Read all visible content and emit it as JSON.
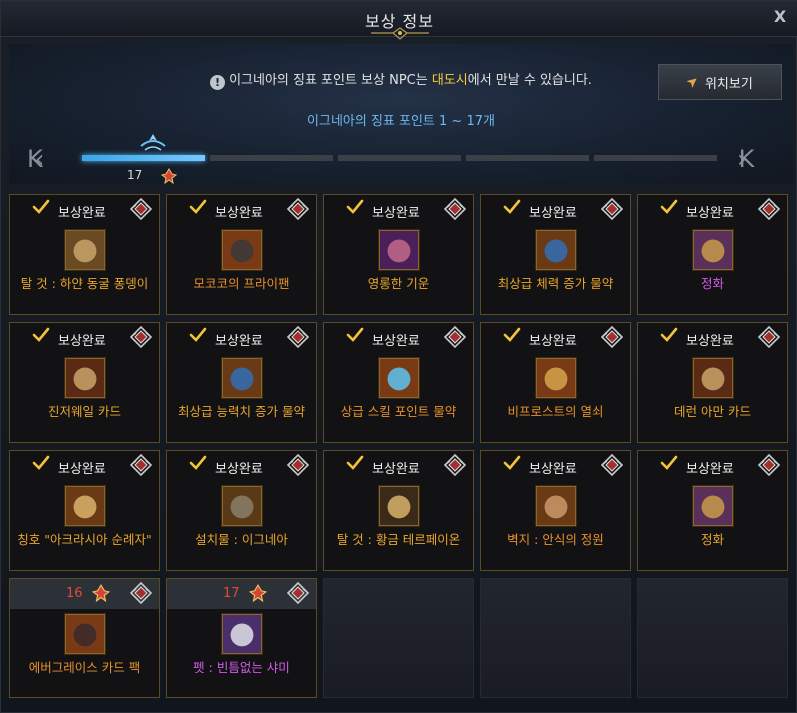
{
  "window": {
    "title": "보상 정보",
    "close_label": "X"
  },
  "info": {
    "notice_prefix": "이그네아의 징표 포인트 보상 NPC는 ",
    "notice_highlight": "대도시",
    "notice_suffix": "에서 만날 수 있습니다.",
    "locate_label": "위치보기",
    "range_label": "이그네아의 징표 포인트 1 ~ 17개",
    "nav_prev": "K‹",
    "nav_next": "›K",
    "current_level": "17",
    "progress_segments": 5,
    "progress_active_segment": 1
  },
  "rewards": [
    {
      "status": "보상완료",
      "name": "탈 것 : 하얀 동굴 퐁뎅이",
      "color": "gold",
      "icon": "pouch-icon"
    },
    {
      "status": "보상완료",
      "name": "모코코의 프라이팬",
      "color": "orange",
      "icon": "frying-pan-icon"
    },
    {
      "status": "보상완료",
      "name": "영롱한 기운",
      "color": "gold",
      "icon": "aura-icon"
    },
    {
      "status": "보상완료",
      "name": "최상급 체력 증가 물약",
      "color": "gold",
      "icon": "potion-icon"
    },
    {
      "status": "보상완료",
      "name": "정화",
      "color": "purple",
      "icon": "rune-icon"
    },
    {
      "status": "보상완료",
      "name": "진저웨일 카드",
      "color": "gold",
      "icon": "card-icon"
    },
    {
      "status": "보상완료",
      "name": "최상급 능력치 증가 물약",
      "color": "gold",
      "icon": "potion-icon"
    },
    {
      "status": "보상완료",
      "name": "상급 스킬 포인트 물약",
      "color": "orange",
      "icon": "bottle-icon"
    },
    {
      "status": "보상완료",
      "name": "비프로스트의 열쇠",
      "color": "orange",
      "icon": "key-icon"
    },
    {
      "status": "보상완료",
      "name": "데런 아만 카드",
      "color": "gold",
      "icon": "card-icon"
    },
    {
      "status": "보상완료",
      "name": "칭호 \"아크라시아 순례자\"",
      "color": "gold",
      "icon": "scroll-icon"
    },
    {
      "status": "보상완료",
      "name": "설치물 : 이그네아",
      "color": "gold",
      "icon": "statue-icon"
    },
    {
      "status": "보상완료",
      "name": "탈 것 : 황금 테르페이온",
      "color": "gold",
      "icon": "horse-icon"
    },
    {
      "status": "보상완료",
      "name": "벽지 : 안식의 정원",
      "color": "orange",
      "icon": "parchment-icon"
    },
    {
      "status": "보상완료",
      "name": "정화",
      "color": "gold",
      "icon": "rune-icon"
    },
    {
      "status_num": "16",
      "name": "에버그레이스 카드 팩",
      "color": "orange",
      "icon": "card-pack-icon"
    },
    {
      "status_num": "17",
      "name": "펫 : 빈틈없는 샤미",
      "color": "purple",
      "icon": "cat-pet-icon"
    }
  ],
  "colors": {
    "gold": "#e9a52b",
    "orange": "#e8902a",
    "purple": "#d35ae8",
    "highlight": "#ffc93a",
    "range": "#6cb8f0",
    "locked_num": "#e5483a"
  }
}
